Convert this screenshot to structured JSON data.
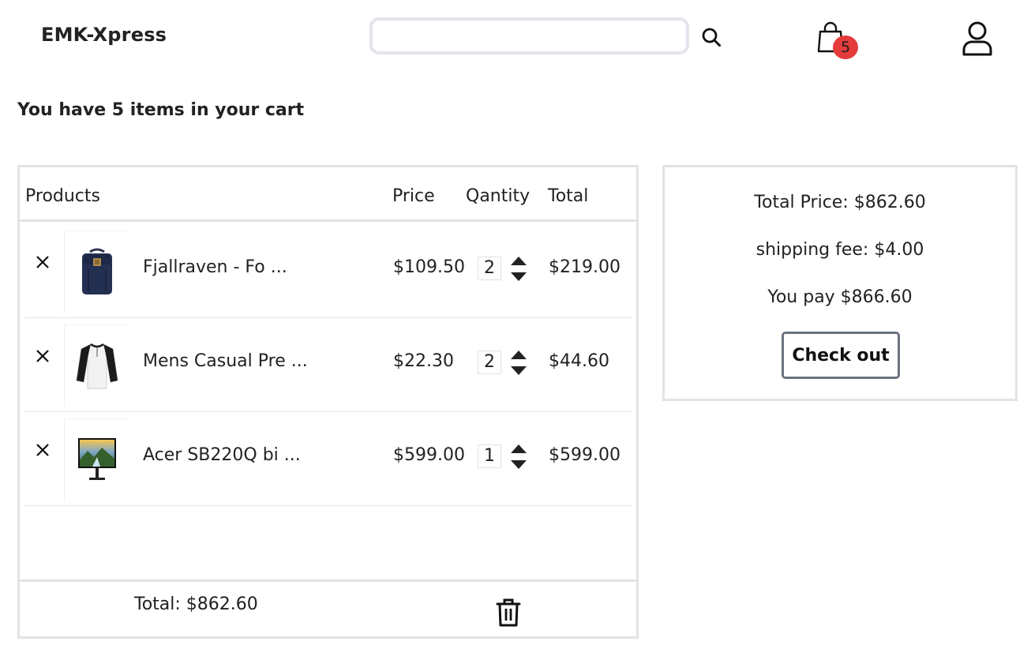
{
  "header": {
    "brand": "EMK-Xpress",
    "search": {
      "value": "",
      "placeholder": ""
    },
    "cart_count": "5",
    "icons": {
      "search": "search-icon",
      "cart": "shopping-bag-icon",
      "user": "user-icon"
    }
  },
  "cart": {
    "heading": "You have 5 items in your cart",
    "columns": {
      "products": "Products",
      "price": "Price",
      "quantity": "Qantity",
      "total": "Total"
    },
    "items": [
      {
        "name": "Fjallraven - Fo ...",
        "price": "$109.50",
        "quantity": "2",
        "total": "$219.00",
        "thumb": "backpack"
      },
      {
        "name": "Mens Casual Pre ...",
        "price": "$22.30",
        "quantity": "2",
        "total": "$44.60",
        "thumb": "raglan-shirt"
      },
      {
        "name": "Acer SB220Q bi ...",
        "price": "$599.00",
        "quantity": "1",
        "total": "$599.00",
        "thumb": "monitor"
      }
    ],
    "footer_total": "Total: $862.60"
  },
  "summary": {
    "total_price": "Total Price: $862.60",
    "shipping_fee": "shipping fee: $4.00",
    "you_pay": "You pay $866.60",
    "checkout_label": "Check out"
  },
  "colors": {
    "badge": "#e53b3b",
    "border": "#e3e3e3",
    "checkout_border": "#6b7280"
  }
}
